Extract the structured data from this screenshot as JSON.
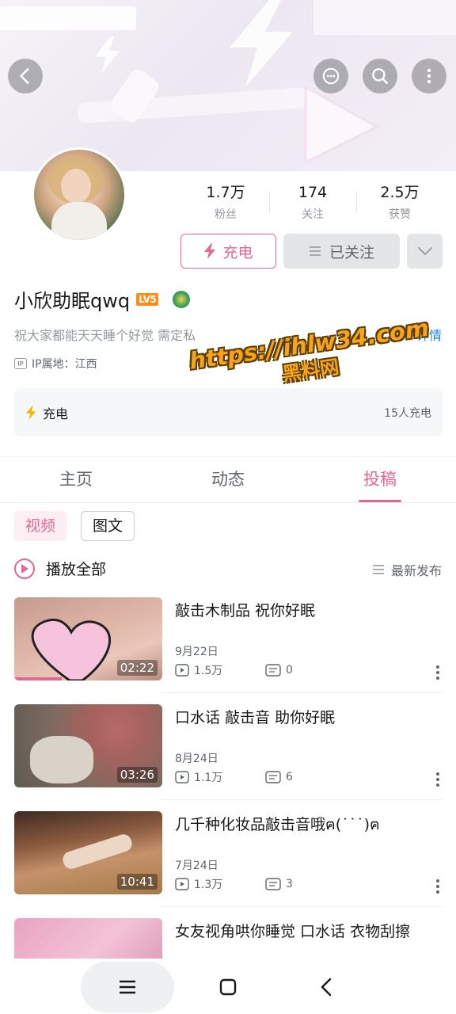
{
  "profile": {
    "stats": [
      {
        "value": "1.7万",
        "label": "粉丝"
      },
      {
        "value": "174",
        "label": "关注"
      },
      {
        "value": "2.5万",
        "label": "获赞"
      }
    ],
    "charge_button": "充电",
    "follow_button": "已关注",
    "name": "小欣助眠qwq",
    "level_badge": "LV5",
    "signature": "祝大家都能天天睡个好觉   需定私",
    "signature_more": "详情",
    "ip_location": "IP属地：江西",
    "ip_icon_text": "IP"
  },
  "watermark": {
    "url": "https://ihlw34.com",
    "text": "黑料网"
  },
  "charge_card": {
    "title": "充电",
    "count": "15人充电"
  },
  "tabs": [
    {
      "label": "主页",
      "active": false
    },
    {
      "label": "动态",
      "active": false
    },
    {
      "label": "投稿",
      "active": true
    }
  ],
  "filters": [
    {
      "label": "视频",
      "active": true
    },
    {
      "label": "图文",
      "active": false
    }
  ],
  "list_header": {
    "play_all": "播放全部",
    "sort": "最新发布"
  },
  "videos": [
    {
      "title": "敲击木制品 祝你好眠",
      "date": "9月22日",
      "views": "1.5万",
      "comments": "0",
      "duration": "02:22"
    },
    {
      "title": "口水话 敲击音 助你好眠",
      "date": "8月24日",
      "views": "1.1万",
      "comments": "6",
      "duration": "03:26"
    },
    {
      "title": "几千种化妆品敲击音哦ฅ(˙˙˙)ฅ",
      "date": "7月24日",
      "views": "1.3万",
      "comments": "3",
      "duration": "10:41"
    },
    {
      "title": "女友视角哄你睡觉 口水话 衣物刮擦",
      "date": "",
      "views": "",
      "comments": "",
      "duration": ""
    }
  ],
  "colors": {
    "accent_pink": "#e2688f",
    "link_blue": "#2187d8",
    "level_orange": "#ff8c1a",
    "watermark_orange": "#f7a31b"
  },
  "icons": {
    "back": "back-arrow-icon",
    "message": "message-bubble-icon",
    "search": "search-icon",
    "more": "more-vertical-icon",
    "charge": "lightning-icon",
    "follow": "list-icon",
    "dropdown": "chevron-down-icon",
    "play": "play-circle-icon",
    "sort": "sort-lines-icon",
    "views": "play-box-icon",
    "comments": "comment-box-icon",
    "nav_recents": "recents-icon",
    "nav_home": "home-icon",
    "nav_back": "nav-back-icon"
  }
}
